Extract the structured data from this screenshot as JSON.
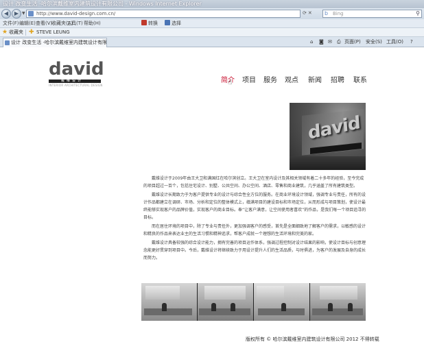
{
  "browser": {
    "window_title": "设计 改变生活 -哈尔滨戴维室内建筑设计有限公司 - Windows Internet Explorer",
    "url": "http://www.david-design.com.cn/",
    "search_placeholder": "Bing",
    "menu": [
      "文件(F)",
      "编辑(E)",
      "查看(V)",
      "收藏夹(A)",
      "工具(T)",
      "帮助(H)"
    ],
    "toolbar": {
      "convert": "转换",
      "select": "选择"
    },
    "favorites": {
      "label": "收藏夹",
      "link": "STEVE LEUNG"
    },
    "tab_title": "设计 改变生活 -哈尔滨戴维室内建筑设计有限公司",
    "commands": {
      "page": "页面(P)",
      "safety": "安全(S)",
      "tools": "工具(O)"
    }
  },
  "site": {
    "logo": {
      "word": "david",
      "bar_text": "戴维设计",
      "sub": "INTERIOR ARCHITECTURAL DESIGN"
    },
    "nav": [
      {
        "label": "简介",
        "active": true
      },
      {
        "label": "项目"
      },
      {
        "label": "服务"
      },
      {
        "label": "观点"
      },
      {
        "label": "新闻"
      },
      {
        "label": "招聘"
      },
      {
        "label": "联系"
      }
    ],
    "intro": [
      "戴维设计于2009年由王大卫和满国红在哈尔滨创立。王大卫在室内设计及其相关领域有着二十多年的经验，至今完成的项目超过一百个，包括住宅设计、别墅、公共空间、办公空间、酒店、零售和商业建筑，几乎涵盖了所有建筑类型。",
      "戴维设计长期致力于为客户提供专业的设计与综合性全方位的服务。在商业环境设计领域，强调专业与责任，所有的设计作品都建立在调研、市场、分析和定位的整体模式上，缜满项目的建设目标和市场定位，从而形成与项目策划，使设计最终能够实现客户的品牌价值，实现客户的商业目标。奉“让客户满意，让空间使用者喜欢”的作品，是我们每一个项目追寻的目标。",
      "而在居住环境的项目中，除了专业与责任外，更加强调客户的感受，首先是全面细致地了解客户的需求，以敏感的设计和精良的作品来表达业主的生活习惯和精神追求，帮客户成就一个理想的生活环境和完美的家。",
      "戴维设计具备较强的综合设计能力，拥有完善的项目运作体系，强调过程控制对设计结果的影响，使设计目标与创意理念能更好贯穿到项目中。今后，戴维设计将继续致力于用设计提升人们的生活品质，与时俱进，为客户的发展及自身的成长而努力。"
    ],
    "footer": "版权所有 © 哈尔滨戴维室内建筑设计有限公司 2012  不得转载"
  }
}
